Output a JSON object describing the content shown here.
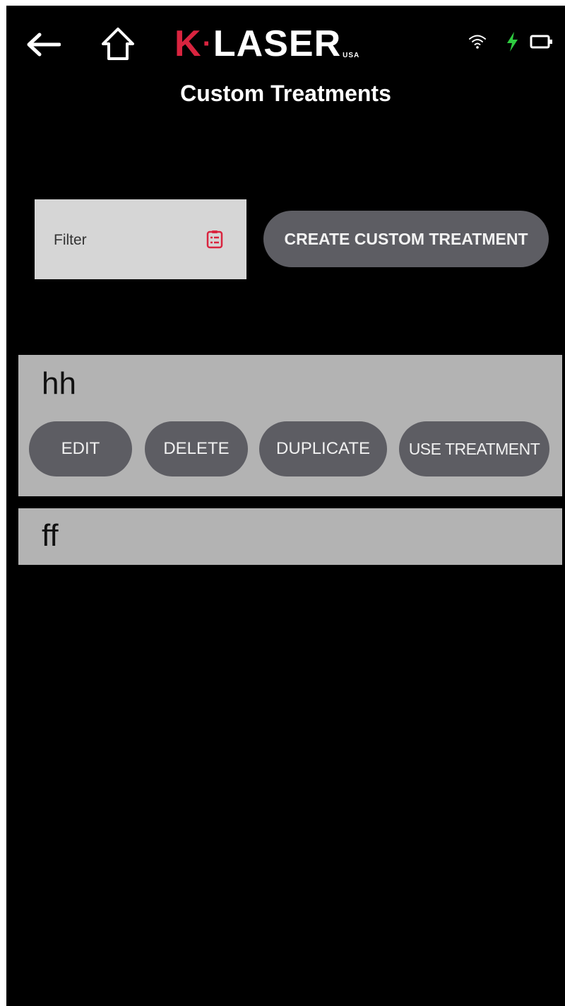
{
  "header": {
    "logo_text_k": "K",
    "logo_text_dot": "·",
    "logo_text_laser": "LASER",
    "logo_text_usa": "USA",
    "page_title": "Custom Treatments",
    "icons": {
      "back": "back-arrow-icon",
      "home": "home-icon",
      "wifi": "wifi-icon",
      "charging": "charging-bolt-icon",
      "battery": "battery-icon"
    }
  },
  "filter": {
    "placeholder": "Filter",
    "icon": "list-filter-icon"
  },
  "create_button_label": "CREATE CUSTOM TREATMENT",
  "treatments": [
    {
      "name": "hh",
      "expanded": true,
      "actions": [
        "EDIT",
        "DELETE",
        "DUPLICATE",
        "USE TREATMENT"
      ]
    },
    {
      "name": "ff",
      "expanded": false
    }
  ],
  "colors": {
    "brand_red": "#d9243f",
    "charging_green": "#2ecc40",
    "button_gray": "#5d5d63",
    "card_gray": "#b3b3b3",
    "filter_bg": "#d6d6d6"
  }
}
